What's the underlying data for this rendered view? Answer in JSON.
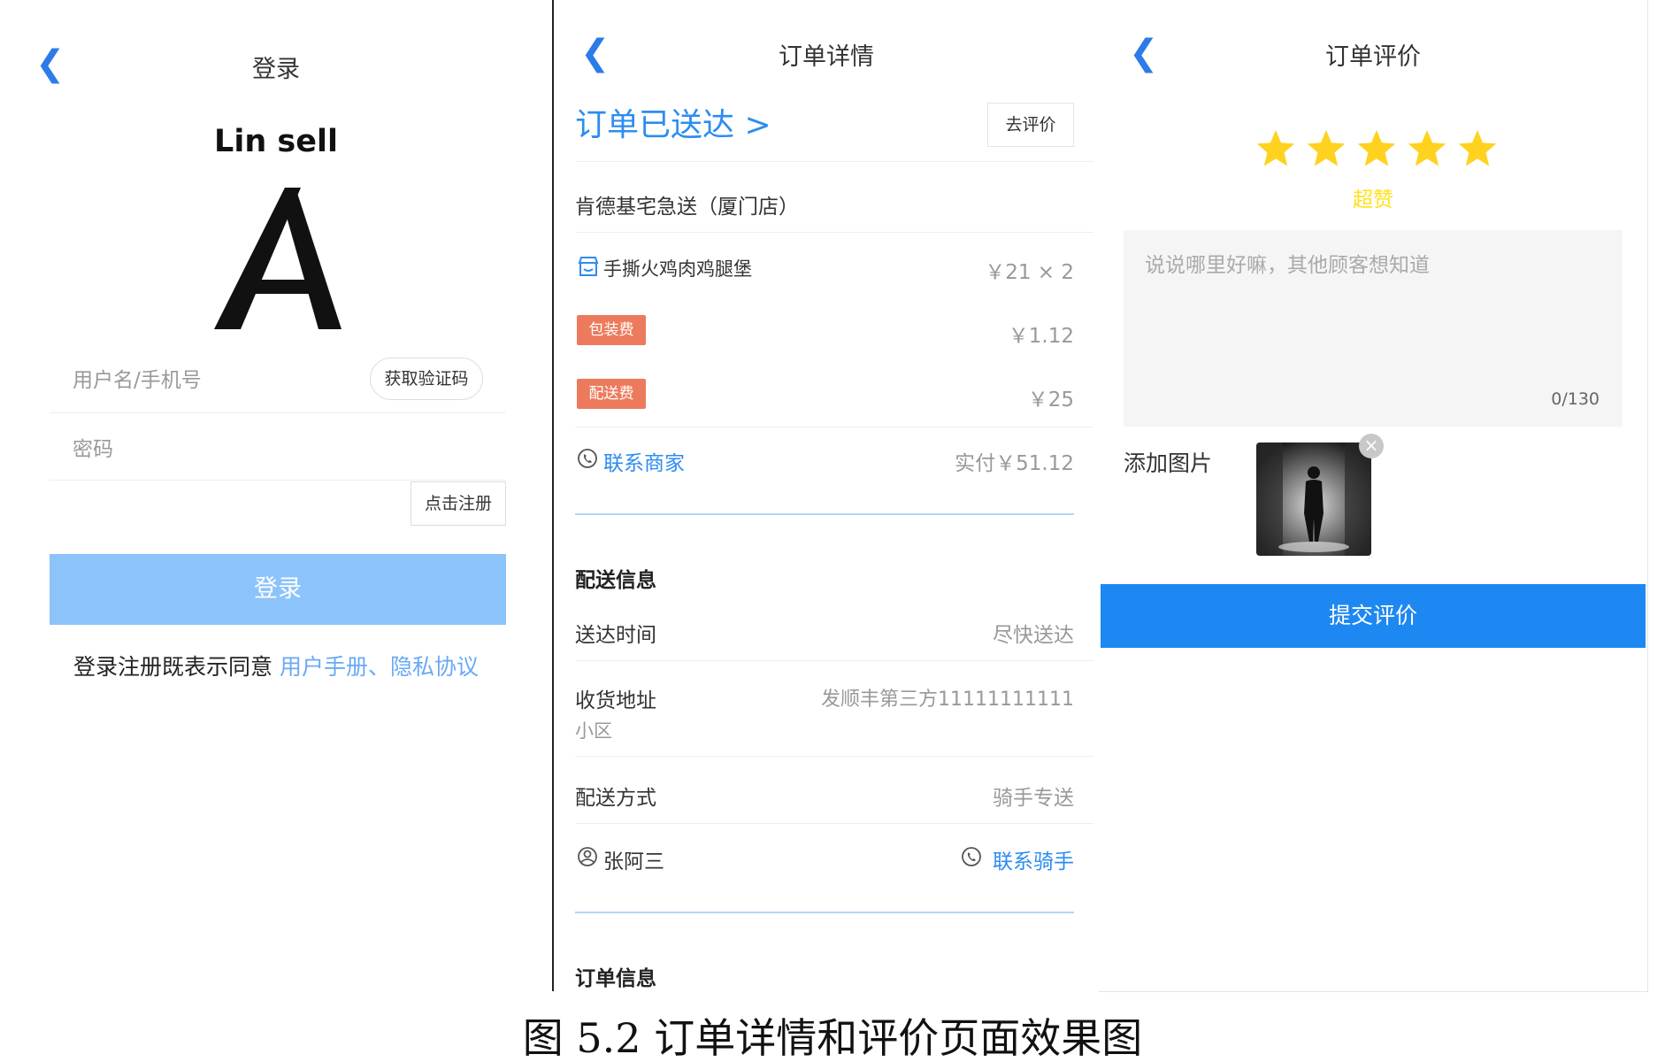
{
  "login": {
    "title": "登录",
    "brand": "Lin sell",
    "username_placeholder": "用户名/手机号",
    "get_code_label": "获取验证码",
    "password_placeholder": "密码",
    "register_label": "点击注册",
    "login_button": "登录",
    "agreement_prefix": "登录注册既表示同意",
    "agreement_links": "用户手册、隐私协议"
  },
  "order": {
    "title": "订单详情",
    "status": "订单已送达 >",
    "review_button": "去评价",
    "shop_name": "肯德基宅急送（厦门店）",
    "item_name": "手撕火鸡肉鸡腿堡",
    "item_price": "￥21 × 2",
    "packaging_tag": "包装费",
    "packaging_fee": "￥1.12",
    "delivery_tag": "配送费",
    "delivery_fee": "￥25",
    "contact_merchant": "联系商家",
    "paid_total": "实付￥51.12",
    "delivery_section": "配送信息",
    "delivery_time_label": "送达时间",
    "delivery_time_value": "尽快送达",
    "address_label": "收货地址",
    "address_value": "发顺丰第三方11111111111",
    "address_sub": "小区",
    "delivery_method_label": "配送方式",
    "delivery_method_value": "骑手专送",
    "rider_name": "张阿三",
    "contact_rider": "联系骑手",
    "order_section": "订单信息"
  },
  "review": {
    "title": "订单评价",
    "rating": 5,
    "rating_text": "超赞",
    "placeholder": "说说哪里好嘛，其他顾客想知道",
    "counter": "0/130",
    "add_image_label": "添加图片",
    "submit_button": "提交评价"
  },
  "caption": "图 5.2 订单详情和评价页面效果图",
  "colors": {
    "accent": "#2d8cf0",
    "login_button": "#8cc3fa",
    "submit_button": "#1e88f2",
    "tag": "#ed7a5c",
    "star": "#ffd21f"
  }
}
